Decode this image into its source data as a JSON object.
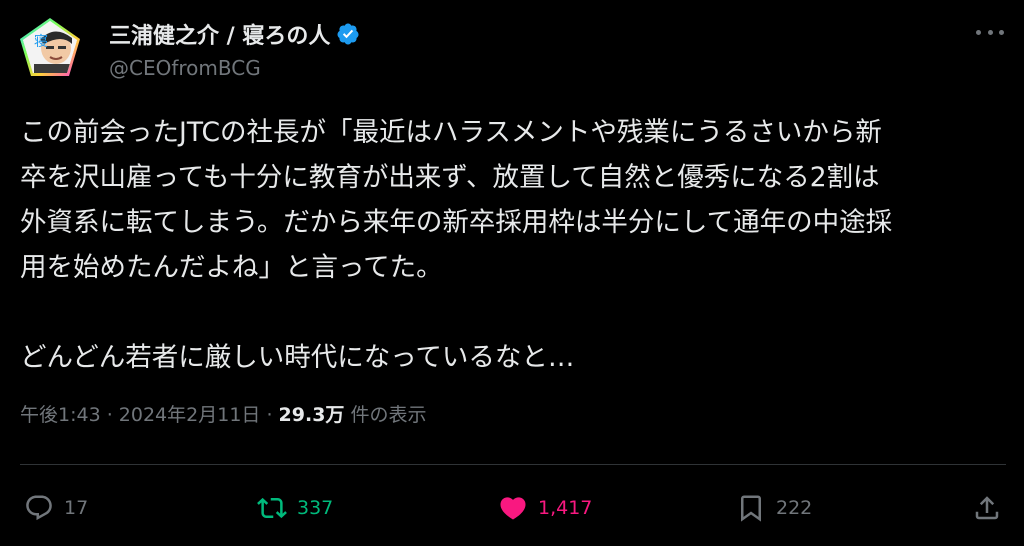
{
  "author": {
    "display_name": "三浦健之介 / 寝ろの人",
    "handle": "@CEOfromBCG",
    "avatar_badge_char": "寝",
    "verified_icon": "verified-badge-icon",
    "verified_color": "#1d9bf0"
  },
  "tweet": {
    "lines": [
      "この前会ったJTCの社長が「最近はハラスメントや残業にうるさいから新",
      "卒を沢山雇っても十分に教育が出来ず、放置して自然と優秀になる2割は",
      "外資系に転てしまう。だから来年の新卒採用枠は半分にして通年の中途採",
      "用を始めたんだよね」と言ってた。",
      "どんどん若者に厳しい時代になっているなと…"
    ]
  },
  "meta": {
    "time": "午後1:43",
    "separator": " · ",
    "date": "2024年2月11日",
    "views_count": "29.3万",
    "views_label": " 件の表示"
  },
  "actions": {
    "reply_count": "17",
    "retweet_count": "337",
    "like_count": "1,417",
    "bookmark_count": "222"
  },
  "colors": {
    "background": "#000000",
    "text_primary": "#e7e9ea",
    "text_secondary": "#71767b",
    "retweet_active": "#00ba7c",
    "like_active": "#f91880",
    "divider": "#2f3336"
  },
  "icons": [
    "more-icon",
    "reply-icon",
    "retweet-icon",
    "like-icon",
    "bookmark-icon",
    "share-icon"
  ]
}
